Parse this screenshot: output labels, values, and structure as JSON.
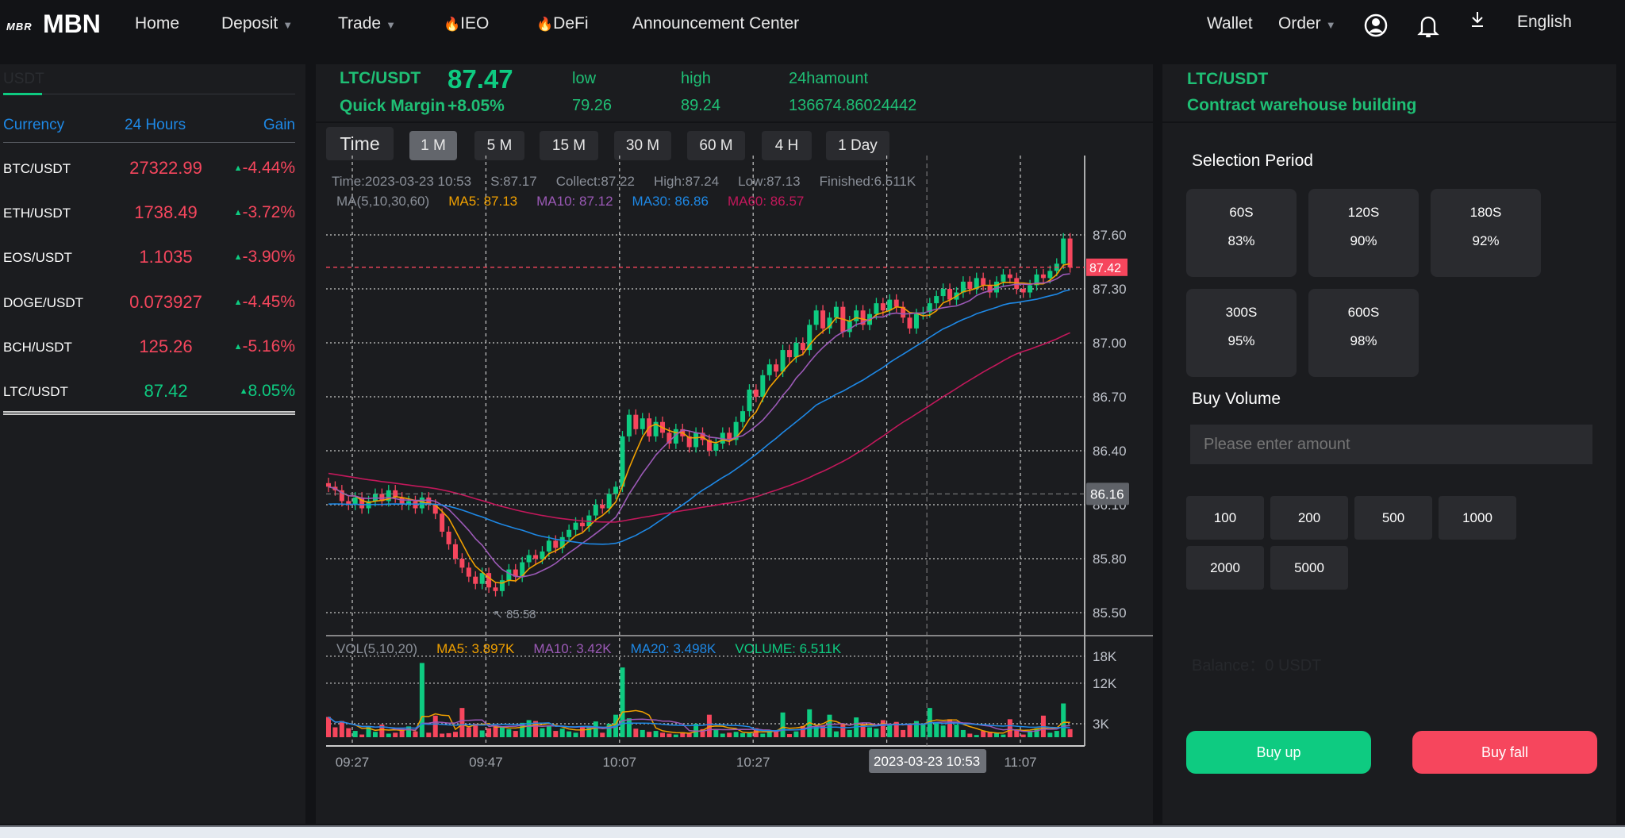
{
  "header": {
    "logo_small": "MBR",
    "logo": "MBN",
    "nav": [
      {
        "label": "Home"
      },
      {
        "label": "Deposit",
        "caret": true
      },
      {
        "label": "Trade",
        "caret": true
      },
      {
        "label": "IEO",
        "fire": true
      },
      {
        "label": "DeFi",
        "fire": true
      },
      {
        "label": "Announcement Center"
      }
    ],
    "wallet": "Wallet",
    "order": "Order",
    "language": "English",
    "icons": [
      "user-circle-icon",
      "bell-icon",
      "download-icon"
    ]
  },
  "markets": {
    "tab": "USDT",
    "columns": [
      "Currency",
      "24 Hours",
      "Gain"
    ],
    "rows": [
      {
        "pair": "BTC/USDT",
        "price": "27322.99",
        "gain": "-4.44%",
        "up": false
      },
      {
        "pair": "ETH/USDT",
        "price": "1738.49",
        "gain": "-3.72%",
        "up": false
      },
      {
        "pair": "EOS/USDT",
        "price": "1.1035",
        "gain": "-3.90%",
        "up": false
      },
      {
        "pair": "DOGE/USDT",
        "price": "0.073927",
        "gain": "-4.45%",
        "up": false
      },
      {
        "pair": "BCH/USDT",
        "price": "125.26",
        "gain": "-5.16%",
        "up": false
      },
      {
        "pair": "LTC/USDT",
        "price": "87.42",
        "gain": "8.05%",
        "up": true
      }
    ]
  },
  "ticker": {
    "pair": "LTC/USDT",
    "price": "87.47",
    "margin_label": "Quick Margin",
    "margin": "+8.05%",
    "low_label": "low",
    "low": "79.26",
    "high_label": "high",
    "high": "89.24",
    "amount_label": "24hamount",
    "amount": "136674.86024442"
  },
  "timeframes": {
    "time_label": "Time",
    "items": [
      "1 M",
      "5 M",
      "15 M",
      "30 M",
      "60 M",
      "4 H",
      "1 Day"
    ],
    "active": 0
  },
  "info": {
    "time": "Time:2023-03-23 10:53",
    "s": "S:87.17",
    "collect": "Collect:87.22",
    "high": "High:87.24",
    "low": "Low:87.13",
    "finished": "Finished:6.511K",
    "ma_label": "MA(5,10,30,60)",
    "ma5": "MA5: 87.13",
    "ma10": "MA10: 87.12",
    "ma30": "MA30: 86.86",
    "ma60": "MA60: 86.57",
    "vol_label": "VOL(5,10,20)",
    "vma5": "MA5: 3.897K",
    "vma10": "MA10: 3.42K",
    "vma20": "MA20: 3.498K",
    "volume": "VOLUME: 6.511K"
  },
  "chart_data": {
    "type": "candlestick",
    "interval": "1m",
    "start": "09:23",
    "close": [
      86.2,
      86.18,
      86.12,
      86.1,
      86.14,
      86.08,
      86.12,
      86.16,
      86.12,
      86.18,
      86.14,
      86.1,
      86.12,
      86.08,
      86.14,
      86.1,
      86.05,
      85.95,
      85.88,
      85.8,
      85.75,
      85.7,
      85.66,
      85.72,
      85.64,
      85.62,
      85.68,
      85.74,
      85.7,
      85.78,
      85.82,
      85.8,
      85.84,
      85.9,
      85.86,
      85.92,
      85.96,
      86.0,
      85.98,
      86.04,
      86.1,
      86.08,
      86.16,
      86.2,
      86.48,
      86.6,
      86.52,
      86.58,
      86.48,
      86.56,
      86.5,
      86.44,
      86.52,
      86.48,
      86.42,
      86.5,
      86.46,
      86.4,
      86.44,
      86.5,
      86.46,
      86.56,
      86.62,
      86.74,
      86.7,
      86.82,
      86.88,
      86.84,
      86.96,
      86.92,
      87.0,
      86.96,
      87.1,
      87.18,
      87.08,
      87.14,
      87.2,
      87.06,
      87.12,
      87.18,
      87.1,
      87.16,
      87.22,
      87.18,
      87.24,
      87.2,
      87.14,
      87.08,
      87.16,
      87.17,
      87.22,
      87.26,
      87.3,
      87.24,
      87.28,
      87.34,
      87.3,
      87.36,
      87.32,
      87.28,
      87.34,
      87.38,
      87.36,
      87.3,
      87.28,
      87.32,
      87.38,
      87.36,
      87.4,
      87.44,
      87.58,
      87.42
    ],
    "volume_k": [
      4.5,
      2.2,
      3.6,
      2.0,
      1.4,
      0.6,
      2.5,
      1.2,
      2.8,
      0.8,
      1.0,
      1.8,
      2.4,
      1.3,
      16.5,
      1.0,
      4.8,
      0.8,
      0.9,
      1.2,
      6.5,
      2.2,
      3.0,
      1.5,
      2.0,
      2.6,
      2.4,
      1.8,
      1.4,
      3.2,
      3.8,
      3.6,
      2.0,
      2.6,
      1.4,
      1.9,
      1.3,
      1.0,
      2.4,
      2.1,
      3.5,
      1.0,
      3.0,
      5.0,
      15.5,
      4.2,
      1.9,
      1.6,
      1.2,
      1.4,
      1.0,
      0.8,
      0.6,
      1.1,
      0.9,
      3.0,
      1.8,
      5.0,
      1.7,
      0.8,
      1.0,
      1.2,
      0.9,
      1.0,
      2.0,
      0.8,
      1.4,
      1.5,
      5.5,
      0.7,
      1.3,
      2.5,
      6.2,
      2.4,
      2.6,
      5.0,
      1.3,
      3.0,
      1.6,
      4.4,
      3.0,
      2.2,
      1.9,
      3.8,
      3.0,
      3.4,
      1.6,
      3.0,
      3.6,
      2.8,
      6.5,
      3.3,
      2.6,
      4.0,
      2.8,
      1.6,
      0.8,
      0.5,
      1.4,
      1.2,
      0.9,
      0.6,
      4.0,
      1.5,
      0.6,
      1.2,
      2.0,
      4.8,
      1.0,
      1.4,
      7.5,
      1.8
    ],
    "price_ticks": [
      "87.60",
      "87.30",
      "87.00",
      "86.70",
      "86.40",
      "86.10",
      "85.80",
      "85.50"
    ],
    "volume_ticks": [
      "18K",
      "12K",
      "3K"
    ],
    "time_ticks": [
      "09:27",
      "09:47",
      "10:07",
      "10:27",
      "11:07"
    ],
    "last_price": "87.42",
    "crosshair_price": "86.16",
    "crosshair_time": "2023-03-23 10:53",
    "low_marker": "85.58",
    "colors": {
      "up": "#0ecb81",
      "down": "#f6465d",
      "ma5": "#f0a000",
      "ma10": "#9b59b6",
      "ma30": "#1e88e5",
      "ma60": "#c2185b"
    }
  },
  "trade": {
    "pair": "LTC/USDT",
    "subtitle": "Contract warehouse building",
    "period_label": "Selection Period",
    "periods": [
      {
        "t": "60S",
        "r": "83%"
      },
      {
        "t": "120S",
        "r": "90%"
      },
      {
        "t": "180S",
        "r": "92%"
      },
      {
        "t": "300S",
        "r": "95%"
      },
      {
        "t": "600S",
        "r": "98%"
      }
    ],
    "volume_label": "Buy Volume",
    "placeholder": "Please enter amount",
    "amounts": [
      "100",
      "200",
      "500",
      "1000",
      "2000",
      "5000"
    ],
    "balance": "Balance：0 USDT",
    "buy_up": "Buy up",
    "buy_fall": "Buy fall",
    "up_color": "#0ecb81",
    "fall_color": "#f6465d"
  }
}
